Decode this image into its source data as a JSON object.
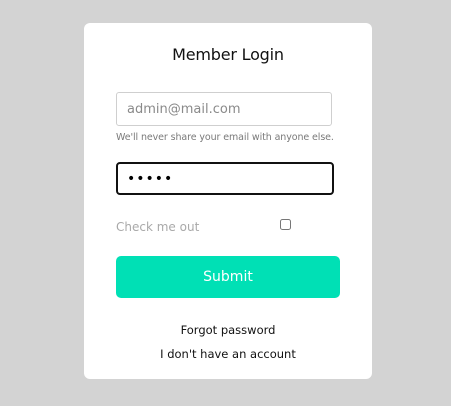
{
  "colors": {
    "page_background": "#d3d3d3",
    "card_background": "#ffffff",
    "accent": "#00e0b5"
  },
  "login": {
    "title": "Member Login",
    "email_placeholder": "admin@mail.com",
    "email_help": "We'll never share your email with anyone else.",
    "password_value": "•••••",
    "remember_label": "Check me out",
    "remember_checked": false,
    "submit_label": "Submit",
    "forgot_label": "Forgot password",
    "signup_label": "I don't have an account"
  }
}
